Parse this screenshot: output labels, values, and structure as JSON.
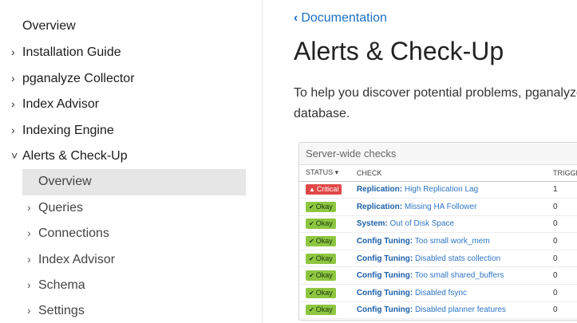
{
  "sidebar": {
    "top_item": "Overview",
    "items": [
      {
        "chevron": "›",
        "label": "Installation Guide"
      },
      {
        "chevron": "›",
        "label": "pganalyze Collector"
      },
      {
        "chevron": "›",
        "label": "Index Advisor"
      },
      {
        "chevron": "›",
        "label": "Indexing Engine"
      },
      {
        "chevron": "˅",
        "label": "Alerts & Check-Up"
      }
    ],
    "active_sub_item": "Overview",
    "sub_items": [
      {
        "label": "Queries"
      },
      {
        "label": "Connections"
      },
      {
        "label": "Index Advisor"
      },
      {
        "label": "Schema"
      },
      {
        "label": "Settings"
      }
    ]
  },
  "main": {
    "breadcrumb": "Documentation",
    "title": "Alerts & Check-Up",
    "intro": "To help you discover potential problems, pganalyze checks your database."
  },
  "card": {
    "title": "Server-wide checks",
    "columns": [
      "STATUS ▾",
      "CHECK",
      "TRIGGE"
    ],
    "rows": [
      {
        "status": "Critical",
        "status_type": "critical",
        "category": "Replication:",
        "check": "High Replication Lag",
        "triggered": "1"
      },
      {
        "status": "Okay",
        "status_type": "okay",
        "category": "Replication:",
        "check": "Missing HA Follower",
        "triggered": "0"
      },
      {
        "status": "Okay",
        "status_type": "okay",
        "category": "System:",
        "check": "Out of Disk Space",
        "triggered": "0"
      },
      {
        "status": "Okay",
        "status_type": "okay",
        "category": "Config Tuning:",
        "check": "Too small work_mem",
        "triggered": "0"
      },
      {
        "status": "Okay",
        "status_type": "okay",
        "category": "Config Tuning:",
        "check": "Disabled stats collection",
        "triggered": "0"
      },
      {
        "status": "Okay",
        "status_type": "okay",
        "category": "Config Tuning:",
        "check": "Too small shared_buffers",
        "triggered": "0"
      },
      {
        "status": "Okay",
        "status_type": "okay",
        "category": "Config Tuning:",
        "check": "Disabled fsync",
        "triggered": "0"
      },
      {
        "status": "Okay",
        "status_type": "okay",
        "category": "Config Tuning:",
        "check": "Disabled planner features",
        "triggered": "0"
      }
    ]
  },
  "colors": {
    "link": "#1a6fc2",
    "okay": "#8ec641",
    "critical": "#e04848",
    "active_bg": "#e6e6e6"
  }
}
